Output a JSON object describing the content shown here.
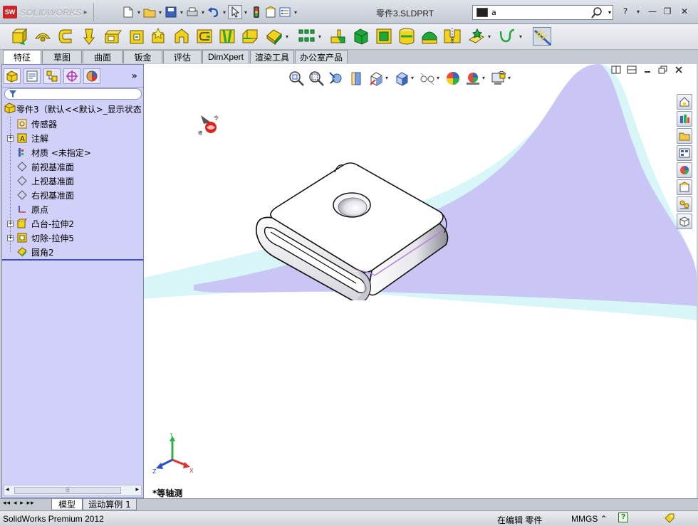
{
  "app": {
    "logo_badge": "SW",
    "logo_text": "SOLIDWORKS",
    "document_title": "零件3.SLDPRT",
    "search_value": "a"
  },
  "window_buttons": {
    "help": "?",
    "minimize": "—",
    "restore": "❐",
    "close": "✕"
  },
  "tabs": [
    "特征",
    "草图",
    "曲面",
    "钣金",
    "评估",
    "DimXpert",
    "渲染工具",
    "办公室产品"
  ],
  "active_tab": "特征",
  "feature_tree": {
    "more": "»",
    "root": "零件3（默认<<默认>_显示状态",
    "items": [
      {
        "label": "传感器",
        "icon": "sensor-icon",
        "expandable": false
      },
      {
        "label": "注解",
        "icon": "annotation-icon",
        "expandable": true
      },
      {
        "label": "材质 <未指定>",
        "icon": "material-icon",
        "expandable": false
      },
      {
        "label": "前视基准面",
        "icon": "plane-icon",
        "expandable": false
      },
      {
        "label": "上视基准面",
        "icon": "plane-icon",
        "expandable": false
      },
      {
        "label": "右视基准面",
        "icon": "plane-icon",
        "expandable": false
      },
      {
        "label": "原点",
        "icon": "origin-icon",
        "expandable": false
      },
      {
        "label": "凸台-拉伸2",
        "icon": "boss-extrude-icon",
        "expandable": true
      },
      {
        "label": "切除-拉伸5",
        "icon": "cut-extrude-icon",
        "expandable": true
      },
      {
        "label": "圆角2",
        "icon": "fillet-icon",
        "expandable": false
      }
    ]
  },
  "viewport": {
    "view_label": "*等轴测",
    "axis_labels": {
      "x": "X",
      "y": "Y",
      "z": "Z"
    }
  },
  "bottom_tabs": [
    "模型",
    "运动算例 1"
  ],
  "status": {
    "product": "SolidWorks Premium 2012",
    "mode": "在编辑 零件",
    "units": "MMGS ⌃",
    "help": "?"
  },
  "colors": {
    "tree_background": "#d0d0f8",
    "scene_glow": "#c9c6f5",
    "scene_cyan": "#d8f5f7",
    "accent_yellow": "#f2d21c"
  }
}
